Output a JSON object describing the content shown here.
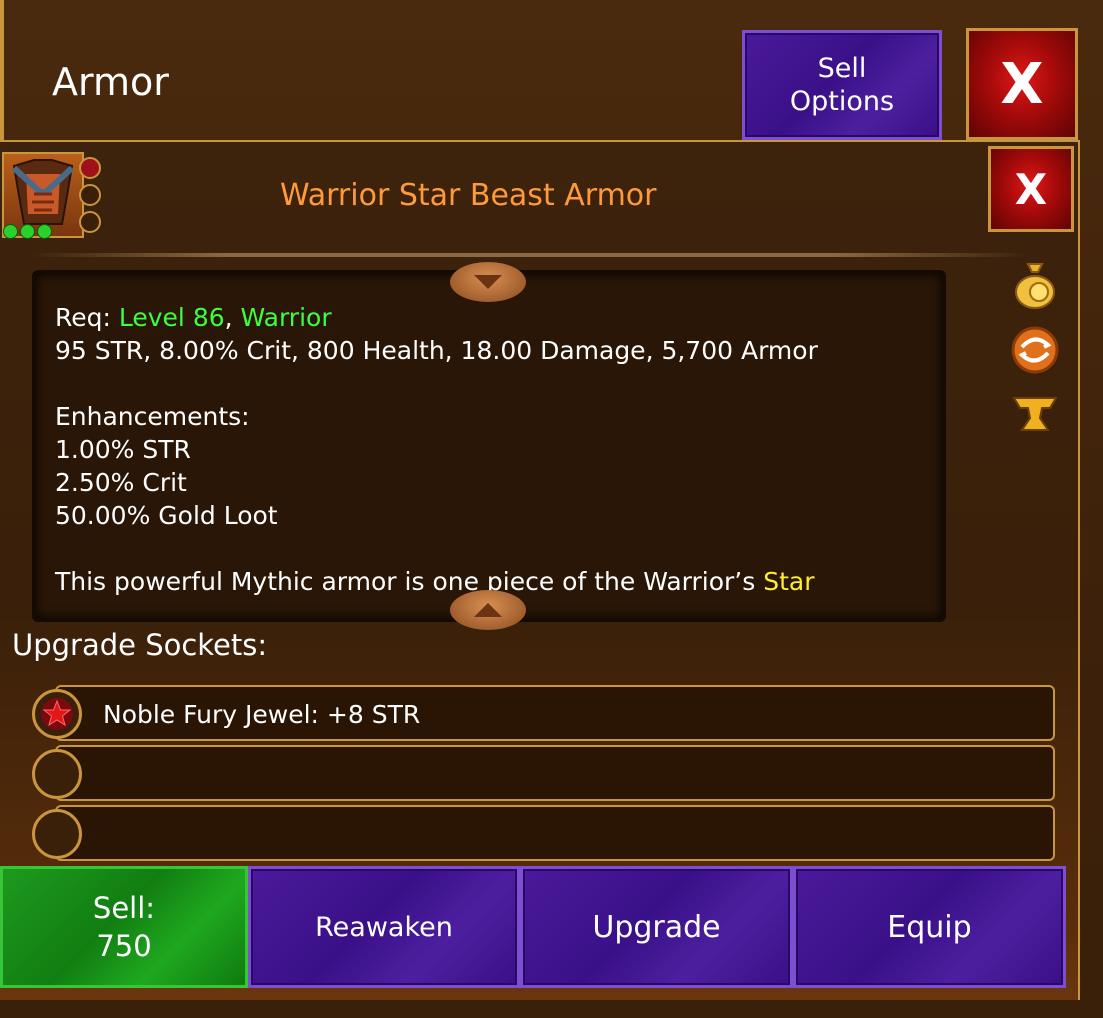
{
  "header": {
    "title": "Armor",
    "sell_options_label": "Sell\nOptions",
    "close_label": "X"
  },
  "item": {
    "name": "Warrior Star Beast Armor",
    "close_label": "X"
  },
  "description": {
    "req_prefix": "Req: ",
    "req_level": "Level 86",
    "req_sep": ", ",
    "req_class": "Warrior",
    "stats": "95 STR, 8.00% Crit, 800 Health, 18.00 Damage, 5,700 Armor",
    "enh_header": "Enhancements:",
    "enh_1": "1.00% STR",
    "enh_2": "2.50% Crit",
    "enh_3": "50.00% Gold Loot",
    "flavor_prefix": "This powerful Mythic armor is one piece of the Warrior’s ",
    "flavor_highlight": "Star"
  },
  "sockets": {
    "label": "Upgrade Sockets:",
    "slots": [
      {
        "text": "Noble Fury Jewel: +8 STR"
      },
      {
        "text": ""
      },
      {
        "text": ""
      }
    ]
  },
  "actions": {
    "sell_label": "Sell:",
    "sell_value": "750",
    "reawaken_label": "Reawaken",
    "upgrade_label": "Upgrade",
    "equip_label": "Equip"
  },
  "colors": {
    "item_name": "#ff9a3a",
    "requirement": "#3bff3b",
    "highlight": "#ffee2e",
    "purple_button": "#3a1088",
    "green_button": "#117e11",
    "close_red": "#a50a0a",
    "gold_border": "#c9953d"
  },
  "icons": [
    "gold-bag-icon",
    "reawaken-icon",
    "anvil-icon",
    "star-jewel-icon"
  ]
}
